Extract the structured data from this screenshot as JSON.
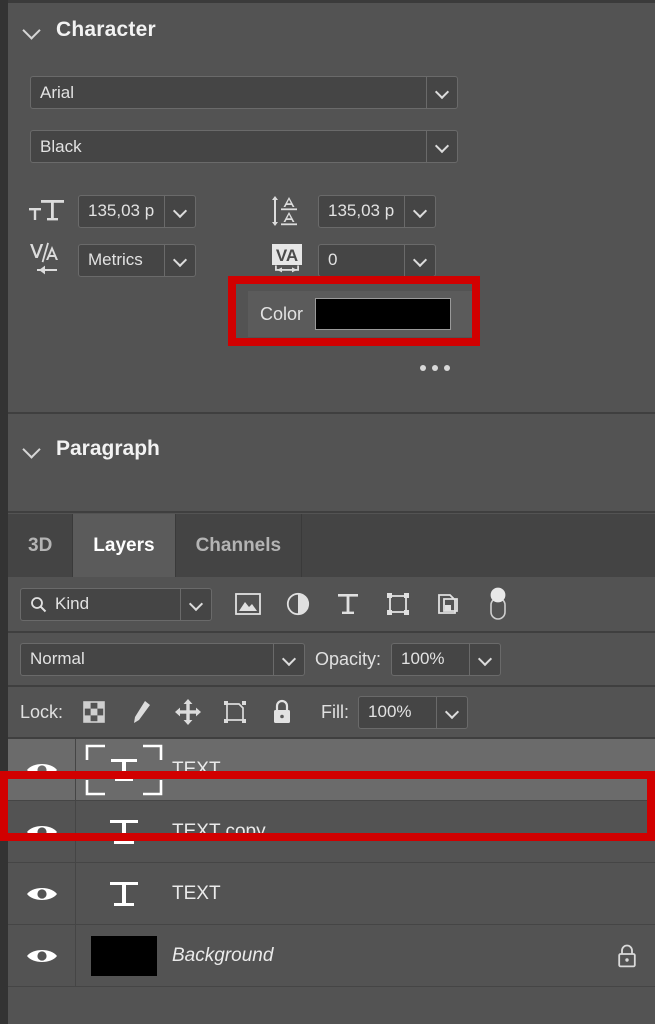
{
  "colors": {
    "panel_bg": "#535353",
    "field_bg": "#454545",
    "tab_bar_bg": "#444444",
    "active_tab_bg": "#5b5b5b",
    "selected_row_bg": "#6b6b6b",
    "annotation_red": "#d10000",
    "text_color": "#eaeaea"
  },
  "character_panel": {
    "title": "Character",
    "collapse_icon": "chevron-down-icon",
    "font_family": {
      "value": "Arial",
      "dropdown_icon": "chevron-down-icon"
    },
    "font_style": {
      "value": "Black",
      "dropdown_icon": "chevron-down-icon"
    },
    "font_size": {
      "icon": "font-size-icon",
      "value": "135,03 p",
      "dropdown_icon": "chevron-down-icon"
    },
    "leading": {
      "icon": "leading-icon",
      "value": "135,03 p",
      "dropdown_icon": "chevron-down-icon"
    },
    "kerning": {
      "icon": "kerning-icon",
      "value": "Metrics",
      "dropdown_icon": "chevron-down-icon"
    },
    "tracking": {
      "icon": "tracking-icon",
      "value": "0",
      "dropdown_icon": "chevron-down-icon"
    },
    "color": {
      "label": "Color",
      "swatch_hex": "#000000"
    },
    "more_options_icon": "ellipsis-icon"
  },
  "paragraph_panel": {
    "title": "Paragraph",
    "collapse_icon": "chevron-down-icon"
  },
  "tabs": [
    {
      "label": "3D",
      "active": false
    },
    {
      "label": "Layers",
      "active": true
    },
    {
      "label": "Channels",
      "active": false
    }
  ],
  "layers_panel": {
    "filter": {
      "search_icon": "search-icon",
      "kind_value": "Kind",
      "dropdown_icon": "chevron-down-icon",
      "filter_icons": [
        "pixel-layer-filter-icon",
        "adjustment-layer-filter-icon",
        "type-layer-filter-icon",
        "shape-layer-filter-icon",
        "smart-object-filter-icon"
      ],
      "toggle_icon": "filter-toggle-switch"
    },
    "blend": {
      "mode_value": "Normal",
      "mode_dropdown_icon": "chevron-down-icon",
      "opacity_label": "Opacity:",
      "opacity_value": "100%",
      "opacity_dropdown_icon": "chevron-down-icon"
    },
    "lock": {
      "label": "Lock:",
      "icons": [
        "lock-transparent-pixels-icon",
        "lock-image-pixels-icon",
        "lock-position-icon",
        "lock-artboard-nesting-icon",
        "lock-all-icon"
      ],
      "fill_label": "Fill:",
      "fill_value": "100%",
      "fill_dropdown_icon": "chevron-down-icon"
    },
    "rows": [
      {
        "visible_icon": "eye-icon",
        "thumbnail": "type-layer-selected-thumb",
        "name": "TEXT",
        "selected": true,
        "locked": false,
        "italic": false
      },
      {
        "visible_icon": "eye-icon",
        "thumbnail": "type-layer-thumb",
        "name": "TEXT copy",
        "selected": false,
        "locked": false,
        "italic": false
      },
      {
        "visible_icon": "eye-icon",
        "thumbnail": "type-layer-thumb",
        "name": "TEXT",
        "selected": false,
        "locked": false,
        "italic": false
      },
      {
        "visible_icon": "eye-icon",
        "thumbnail": "black-swatch-thumb",
        "name": "Background",
        "selected": false,
        "locked": true,
        "italic": true,
        "lock_icon": "lock-icon"
      }
    ]
  },
  "annotations": [
    {
      "name": "color-row-highlight",
      "target": "Color"
    },
    {
      "name": "selected-layer-highlight",
      "target": "TEXT"
    }
  ]
}
